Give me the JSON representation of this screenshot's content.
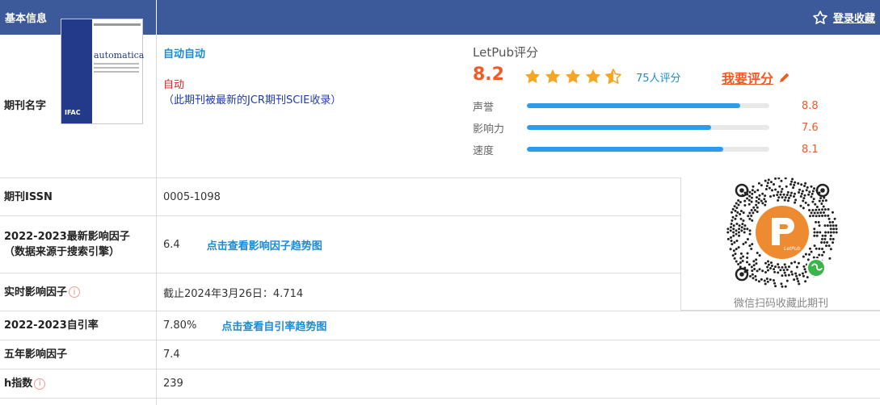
{
  "header": {
    "title": "基本信息",
    "favorite_label": "登录收藏"
  },
  "journal": {
    "label": "期刊名字",
    "name": "自动自动",
    "abbr": "自动",
    "note": "（此期刊被最新的JCR期刊SCIE收录）",
    "cover_title": "automatica",
    "cover_publisher": "IFAC"
  },
  "rating": {
    "title": "LetPub评分",
    "score": "8.2",
    "stars": 4.5,
    "raters": "75人评分",
    "rate_link": "我要评分",
    "metrics": [
      {
        "label": "声誉",
        "value": "8.8",
        "fraction": 0.88
      },
      {
        "label": "影响力",
        "value": "7.6",
        "fraction": 0.76
      },
      {
        "label": "速度",
        "value": "8.1",
        "fraction": 0.81
      }
    ]
  },
  "rows": {
    "issn": {
      "label": "期刊ISSN",
      "value": "0005-1098"
    },
    "if": {
      "label_line1": "2022-2023最新影响因子",
      "label_line2": "（数据来源于搜索引擎）",
      "value": "6.4",
      "link": "点击查看影响因子趋势图"
    },
    "realtime_if": {
      "label": "实时影响因子",
      "value": "截止2024年3月26日：4.714"
    },
    "self_cite": {
      "label": "2022-2023自引率",
      "value": "7.80%",
      "link": "点击查看自引率趋势图"
    },
    "five_year_if": {
      "label": "五年影响因子",
      "value": "7.4"
    },
    "h_index": {
      "label": "h指数",
      "value": "239"
    }
  },
  "qr": {
    "caption": "微信扫码收藏此期刊",
    "logo_text": "LetPub"
  },
  "colors": {
    "header_bg": "#3c5a99",
    "accent_orange": "#f05a24",
    "link_blue": "#1c8bd6",
    "star_gold": "#f5a623",
    "bar_blue": "#2b9cec"
  },
  "icons": {
    "favorite": "star-outline-icon",
    "info": "info-circle-icon",
    "edit": "pencil-icon",
    "mini_program": "wechat-mini-program-icon"
  }
}
